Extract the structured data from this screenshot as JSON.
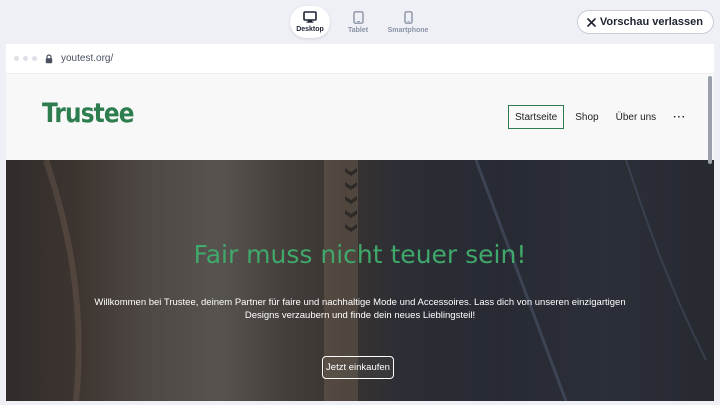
{
  "devices": [
    {
      "label": "Desktop",
      "icon": "desktop-icon",
      "active": true
    },
    {
      "label": "Tablet",
      "icon": "tablet-icon",
      "active": false
    },
    {
      "label": "Smartphone",
      "icon": "smartphone-icon",
      "active": false
    }
  ],
  "exit_button": {
    "label": "Vorschau verlassen",
    "icon": "close-icon"
  },
  "browser": {
    "url": "youtest.org/",
    "icon": "lock-icon"
  },
  "site": {
    "logo": "Trustee",
    "brand_color": "#2e7d4f",
    "nav": {
      "items": [
        "Startseite",
        "Shop",
        "Über uns"
      ],
      "more": "···",
      "active": "Startseite"
    },
    "hero": {
      "title": "Fair muss nicht teuer sein!",
      "text": "Willkommen bei Trustee, deinem Partner für faire und nachhaltige Mode und Accessoires. Lass dich von unseren einzigartigen Designs verzaubern und finde dein neues Lieblingsteil!",
      "button": "Jetzt einkaufen",
      "title_color": "#3fa86a"
    }
  }
}
